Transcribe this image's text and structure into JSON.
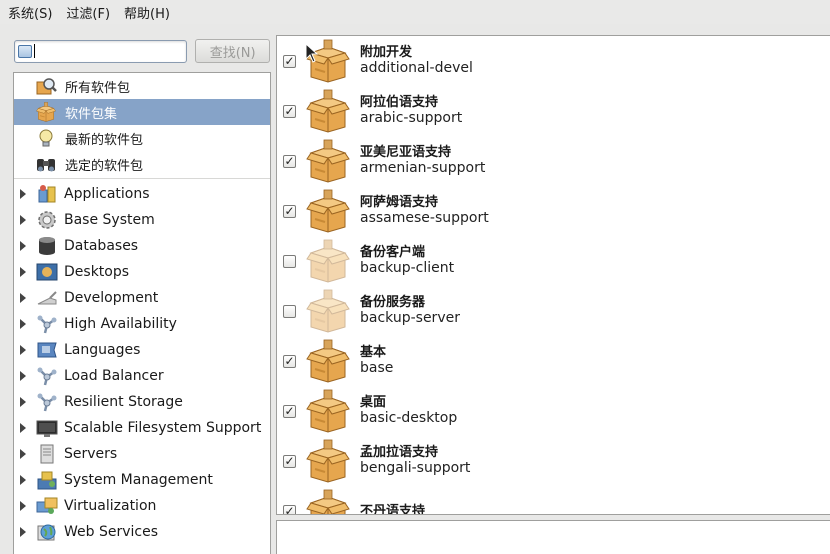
{
  "menu": [
    {
      "label": "系统(S)"
    },
    {
      "label": "过滤(F)"
    },
    {
      "label": "帮助(H)"
    }
  ],
  "search": {
    "value": "",
    "button_label": "查找(N)"
  },
  "filters": [
    {
      "label": "所有软件包",
      "icon": "package-search-icon",
      "selected": false
    },
    {
      "label": "软件包集",
      "icon": "package-box-icon",
      "selected": true
    },
    {
      "label": "最新的软件包",
      "icon": "lightbulb-icon",
      "selected": false
    },
    {
      "label": "选定的软件包",
      "icon": "binoculars-icon",
      "selected": false
    }
  ],
  "groups": [
    {
      "label": "Applications",
      "icon": "applications-icon"
    },
    {
      "label": "Base System",
      "icon": "gear-icon"
    },
    {
      "label": "Databases",
      "icon": "database-icon"
    },
    {
      "label": "Desktops",
      "icon": "desktop-icon"
    },
    {
      "label": "Development",
      "icon": "development-icon"
    },
    {
      "label": "High Availability",
      "icon": "network-icon"
    },
    {
      "label": "Languages",
      "icon": "flag-icon"
    },
    {
      "label": "Load Balancer",
      "icon": "network-icon"
    },
    {
      "label": "Resilient Storage",
      "icon": "network-icon"
    },
    {
      "label": "Scalable Filesystem Support",
      "icon": "monitor-icon"
    },
    {
      "label": "Servers",
      "icon": "server-icon"
    },
    {
      "label": "System Management",
      "icon": "system-management-icon"
    },
    {
      "label": "Virtualization",
      "icon": "virtualization-icon"
    },
    {
      "label": "Web Services",
      "icon": "globe-icon"
    }
  ],
  "packages": [
    {
      "cn": "附加开发",
      "en": "additional-devel",
      "checked": true
    },
    {
      "cn": "阿拉伯语支持",
      "en": "arabic-support",
      "checked": true
    },
    {
      "cn": "亚美尼亚语支持",
      "en": "armenian-support",
      "checked": true
    },
    {
      "cn": "阿萨姆语支持",
      "en": "assamese-support",
      "checked": true
    },
    {
      "cn": "备份客户端",
      "en": "backup-client",
      "checked": false
    },
    {
      "cn": "备份服务器",
      "en": "backup-server",
      "checked": false
    },
    {
      "cn": "基本",
      "en": "base",
      "checked": true
    },
    {
      "cn": "桌面",
      "en": "basic-desktop",
      "checked": true
    },
    {
      "cn": "孟加拉语支持",
      "en": "bengali-support",
      "checked": true
    },
    {
      "cn": "不丹语支持",
      "en": "",
      "checked": true
    }
  ],
  "colors": {
    "selection": "#86a3c8",
    "box_orange": "#e0a850",
    "box_dark": "#b7792a"
  }
}
